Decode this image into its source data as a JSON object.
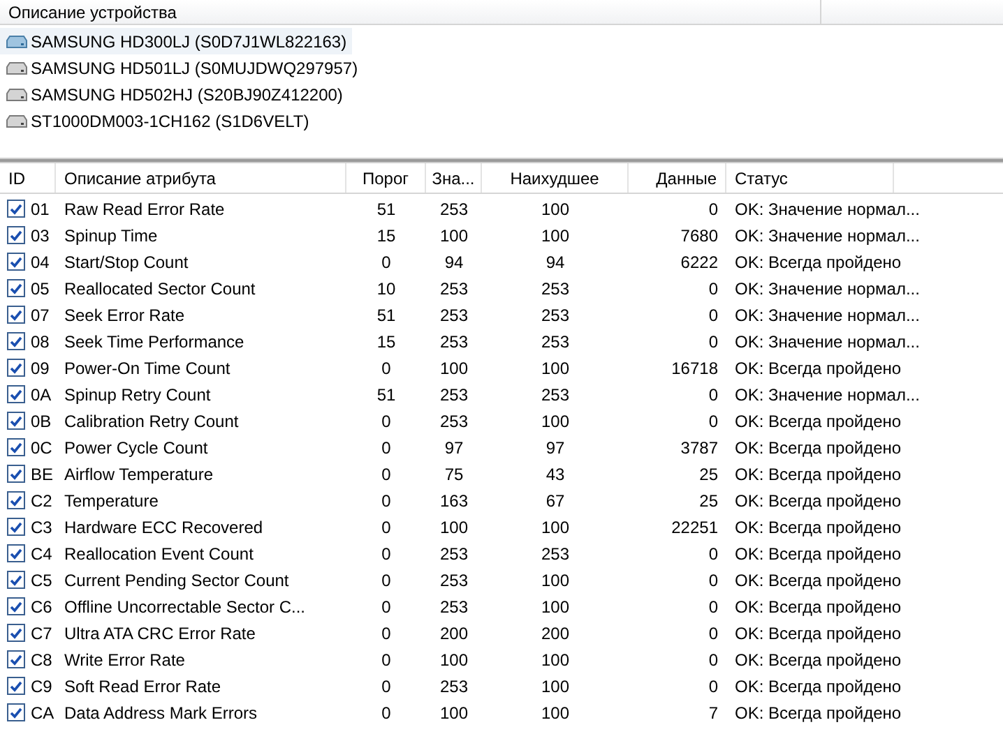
{
  "device_header": "Описание устройства",
  "devices": [
    {
      "name": "SAMSUNG HD300LJ (S0D7J1WL822163)",
      "selected": true
    },
    {
      "name": "SAMSUNG HD501LJ (S0MUJDWQ297957)",
      "selected": false
    },
    {
      "name": "SAMSUNG HD502HJ (S20BJ90Z412200)",
      "selected": false
    },
    {
      "name": "ST1000DM003-1CH162 (S1D6VELT)",
      "selected": false
    }
  ],
  "table": {
    "columns": [
      "ID",
      "Описание атрибута",
      "Порог",
      "Зна...",
      "Наихудшее",
      "Данные",
      "Статус"
    ],
    "rows": [
      {
        "checked": true,
        "id": "01",
        "name": "Raw Read Error Rate",
        "threshold": "51",
        "value": "253",
        "worst": "100",
        "data": "0",
        "status": "OK: Значение нормал..."
      },
      {
        "checked": true,
        "id": "03",
        "name": "Spinup Time",
        "threshold": "15",
        "value": "100",
        "worst": "100",
        "data": "7680",
        "status": "OK: Значение нормал..."
      },
      {
        "checked": true,
        "id": "04",
        "name": "Start/Stop Count",
        "threshold": "0",
        "value": "94",
        "worst": "94",
        "data": "6222",
        "status": "OK: Всегда пройдено"
      },
      {
        "checked": true,
        "id": "05",
        "name": "Reallocated Sector Count",
        "threshold": "10",
        "value": "253",
        "worst": "253",
        "data": "0",
        "status": "OK: Значение нормал..."
      },
      {
        "checked": true,
        "id": "07",
        "name": "Seek Error Rate",
        "threshold": "51",
        "value": "253",
        "worst": "253",
        "data": "0",
        "status": "OK: Значение нормал..."
      },
      {
        "checked": true,
        "id": "08",
        "name": "Seek Time Performance",
        "threshold": "15",
        "value": "253",
        "worst": "253",
        "data": "0",
        "status": "OK: Значение нормал..."
      },
      {
        "checked": true,
        "id": "09",
        "name": "Power-On Time Count",
        "threshold": "0",
        "value": "100",
        "worst": "100",
        "data": "16718",
        "status": "OK: Всегда пройдено"
      },
      {
        "checked": true,
        "id": "0A",
        "name": "Spinup Retry Count",
        "threshold": "51",
        "value": "253",
        "worst": "253",
        "data": "0",
        "status": "OK: Значение нормал..."
      },
      {
        "checked": true,
        "id": "0B",
        "name": "Calibration Retry Count",
        "threshold": "0",
        "value": "253",
        "worst": "100",
        "data": "0",
        "status": "OK: Всегда пройдено"
      },
      {
        "checked": true,
        "id": "0C",
        "name": "Power Cycle Count",
        "threshold": "0",
        "value": "97",
        "worst": "97",
        "data": "3787",
        "status": "OK: Всегда пройдено"
      },
      {
        "checked": true,
        "id": "BE",
        "name": "Airflow Temperature",
        "threshold": "0",
        "value": "75",
        "worst": "43",
        "data": "25",
        "status": "OK: Всегда пройдено"
      },
      {
        "checked": true,
        "id": "C2",
        "name": "Temperature",
        "threshold": "0",
        "value": "163",
        "worst": "67",
        "data": "25",
        "status": "OK: Всегда пройдено"
      },
      {
        "checked": true,
        "id": "C3",
        "name": "Hardware ECC Recovered",
        "threshold": "0",
        "value": "100",
        "worst": "100",
        "data": "22251",
        "status": "OK: Всегда пройдено"
      },
      {
        "checked": true,
        "id": "C4",
        "name": "Reallocation Event Count",
        "threshold": "0",
        "value": "253",
        "worst": "253",
        "data": "0",
        "status": "OK: Всегда пройдено"
      },
      {
        "checked": true,
        "id": "C5",
        "name": "Current Pending Sector Count",
        "threshold": "0",
        "value": "253",
        "worst": "100",
        "data": "0",
        "status": "OK: Всегда пройдено"
      },
      {
        "checked": true,
        "id": "C6",
        "name": "Offline Uncorrectable Sector C...",
        "threshold": "0",
        "value": "253",
        "worst": "100",
        "data": "0",
        "status": "OK: Всегда пройдено"
      },
      {
        "checked": true,
        "id": "C7",
        "name": "Ultra ATA CRC Error Rate",
        "threshold": "0",
        "value": "200",
        "worst": "200",
        "data": "0",
        "status": "OK: Всегда пройдено"
      },
      {
        "checked": true,
        "id": "C8",
        "name": "Write Error Rate",
        "threshold": "0",
        "value": "100",
        "worst": "100",
        "data": "0",
        "status": "OK: Всегда пройдено"
      },
      {
        "checked": true,
        "id": "C9",
        "name": "Soft Read Error Rate",
        "threshold": "0",
        "value": "253",
        "worst": "100",
        "data": "0",
        "status": "OK: Всегда пройдено"
      },
      {
        "checked": true,
        "id": "CA",
        "name": "Data Address Mark Errors",
        "threshold": "0",
        "value": "100",
        "worst": "100",
        "data": "7",
        "status": "OK: Всегда пройдено"
      }
    ]
  }
}
